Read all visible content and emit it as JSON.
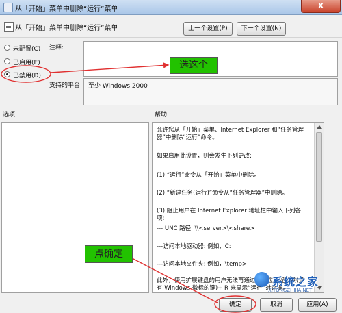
{
  "window": {
    "title": "从「开始」菜单中删除“运行”菜单",
    "close_label": "X"
  },
  "header": {
    "policy_name": "从「开始」菜单中删除“运行”菜单",
    "prev_button": "上一个设置(P)",
    "next_button": "下一个设置(N)"
  },
  "state": {
    "options": [
      {
        "label": "未配置(C)",
        "selected": false
      },
      {
        "label": "已启用(E)",
        "selected": false
      },
      {
        "label": "已禁用(D)",
        "selected": true
      }
    ]
  },
  "comment": {
    "label": "注释:",
    "value": ""
  },
  "supported": {
    "label": "支持的平台:",
    "value": "至少 Windows 2000"
  },
  "options_panel": {
    "label": "选项:"
  },
  "help": {
    "label": "帮助:",
    "paragraphs": [
      "允许您从「开始」菜单、Internet Explorer 和“任务管理器”中删除“运行”命令。",
      "如果启用此设置，则会发生下列更改:",
      "(1) “运行”命令从「开始」菜单中删除。",
      "(2) “新建任务(运行)”命令从“任务管理器”中删除。",
      "(3) 阻止用户在 Internet Explorer 地址栏中输入下列各项:",
      "--- UNC 路径: \\\\<server>\\<share>",
      "---访问本地驱动器: 例如，C:",
      "---访问本地文件夹: 例如，\\temp>",
      "此外，使用扩展键盘的用户无法再通过使用应用程序键(具有 Windows 徽标的键)+ R 来显示“运行”对话框。"
    ]
  },
  "annotations": {
    "select_callout": "选这个",
    "confirm_callout": "点确定",
    "accent_color": "#22c200",
    "marker_color": "#e03030"
  },
  "footer": {
    "ok": "确定",
    "cancel": "取消",
    "apply": "应用(A)"
  },
  "watermark": {
    "name": "系统之家",
    "url": "XITONGZHIJIA.NET"
  }
}
